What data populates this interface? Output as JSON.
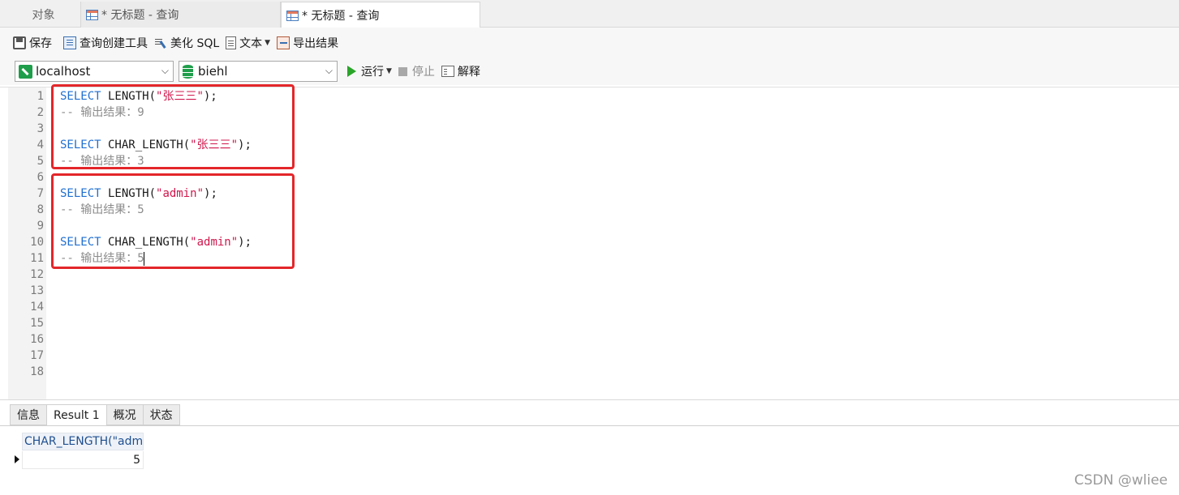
{
  "tabs": [
    {
      "label": "对象"
    },
    {
      "label": "* 无标题 - 查询"
    },
    {
      "label": "* 无标题 - 查询"
    }
  ],
  "toolbar": {
    "save": "保存",
    "query_builder": "查询创建工具",
    "beautify": "美化 SQL",
    "text": "文本",
    "export": "导出结果"
  },
  "connection": {
    "host": "localhost",
    "database": "biehl",
    "run": "运行",
    "stop": "停止",
    "explain": "解释"
  },
  "editor": {
    "line_numbers": [
      "1",
      "2",
      "3",
      "4",
      "5",
      "6",
      "7",
      "8",
      "9",
      "10",
      "11",
      "12",
      "13",
      "14",
      "15",
      "16",
      "17",
      "18"
    ],
    "lines": [
      {
        "kw": "SELECT",
        "fn": " LENGTH(",
        "str": "\"张三三\"",
        "end": ");"
      },
      {
        "comment": "-- 输出结果：9"
      },
      {},
      {
        "kw": "SELECT",
        "fn": " CHAR_LENGTH(",
        "str": "\"张三三\"",
        "end": ");"
      },
      {
        "comment": "-- 输出结果：3"
      },
      {},
      {
        "kw": "SELECT",
        "fn": " LENGTH(",
        "str": "\"admin\"",
        "end": ");"
      },
      {
        "comment": "-- 输出结果：5"
      },
      {},
      {
        "kw": "SELECT",
        "fn": " CHAR_LENGTH(",
        "str": "\"admin\"",
        "end": ");"
      },
      {
        "comment": "-- 输出结果：5"
      }
    ]
  },
  "results": {
    "tabs": [
      "信息",
      "Result 1",
      "概况",
      "状态"
    ],
    "column_header": "CHAR_LENGTH(\"adm",
    "cell_value": "5"
  },
  "watermark": "CSDN @wliee",
  "colors": {
    "keyword": "#1f6fd1",
    "string": "#d0174c",
    "comment": "#8c8c8c",
    "highlight_box": "#e3262a",
    "run_green": "#2aa52a"
  }
}
